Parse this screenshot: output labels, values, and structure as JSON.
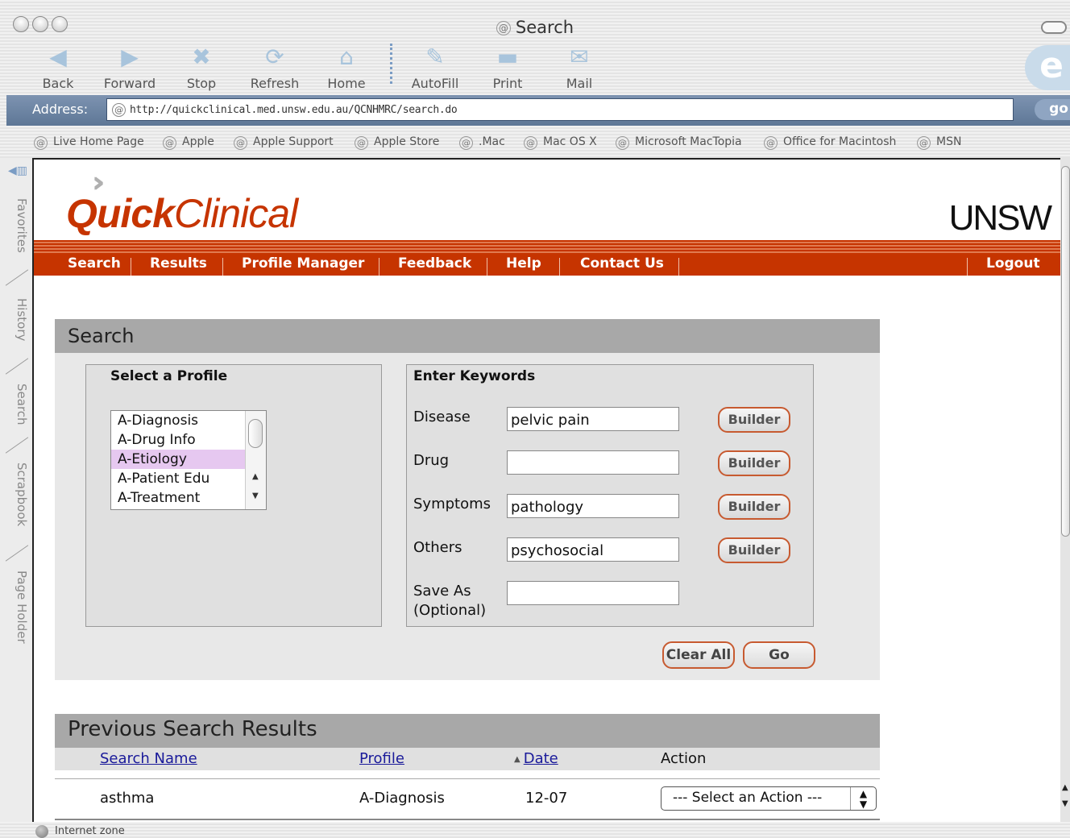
{
  "window": {
    "title": "Search"
  },
  "toolbar": {
    "back": "Back",
    "forward": "Forward",
    "stop": "Stop",
    "refresh": "Refresh",
    "home": "Home",
    "autofill": "AutoFill",
    "print": "Print",
    "mail": "Mail"
  },
  "address": {
    "label": "Address:",
    "url": "http://quickclinical.med.unsw.edu.au/QCNHMRC/search.do",
    "go": "go"
  },
  "favorites": [
    "Live Home Page",
    "Apple",
    "Apple Support",
    "Apple Store",
    ".Mac",
    "Mac OS X",
    "Microsoft MacTopia",
    "Office for Macintosh",
    "MSN"
  ],
  "sidebar_tabs": [
    "Favorites",
    "History",
    "Search",
    "Scrapbook",
    "Page Holder"
  ],
  "brand": {
    "logo_bold": "Quick",
    "logo_light": "Clinical",
    "org": "UNSW"
  },
  "nav": {
    "search": "Search",
    "results": "Results",
    "profile_manager": "Profile Manager",
    "feedback": "Feedback",
    "help": "Help",
    "contact": "Contact Us",
    "logout": "Logout"
  },
  "search_panel": {
    "title": "Search",
    "profile": {
      "title": "Select a Profile",
      "options": [
        "A-Diagnosis",
        "A-Drug Info",
        "A-Etiology",
        "A-Patient Edu",
        "A-Treatment"
      ],
      "selected": "A-Etiology"
    },
    "keywords": {
      "title": "Enter Keywords",
      "disease_label": "Disease",
      "disease_value": "pelvic pain",
      "drug_label": "Drug",
      "drug_value": "",
      "symptoms_label": "Symptoms",
      "symptoms_value": "pathology",
      "others_label": "Others",
      "others_value": "psychosocial",
      "saveas_label": "Save As",
      "saveas_sub": "(Optional)",
      "saveas_value": "",
      "builder": "Builder"
    },
    "clear_all": "Clear All",
    "go": "Go"
  },
  "previous": {
    "title": "Previous Search Results",
    "columns": {
      "name": "Search Name",
      "profile": "Profile",
      "date": "Date",
      "action": "Action"
    },
    "rows": [
      {
        "name": "asthma",
        "profile": "A-Diagnosis",
        "date": "12-07",
        "action": "--- Select an Action ---"
      }
    ]
  },
  "status": {
    "zone": "Internet zone"
  }
}
